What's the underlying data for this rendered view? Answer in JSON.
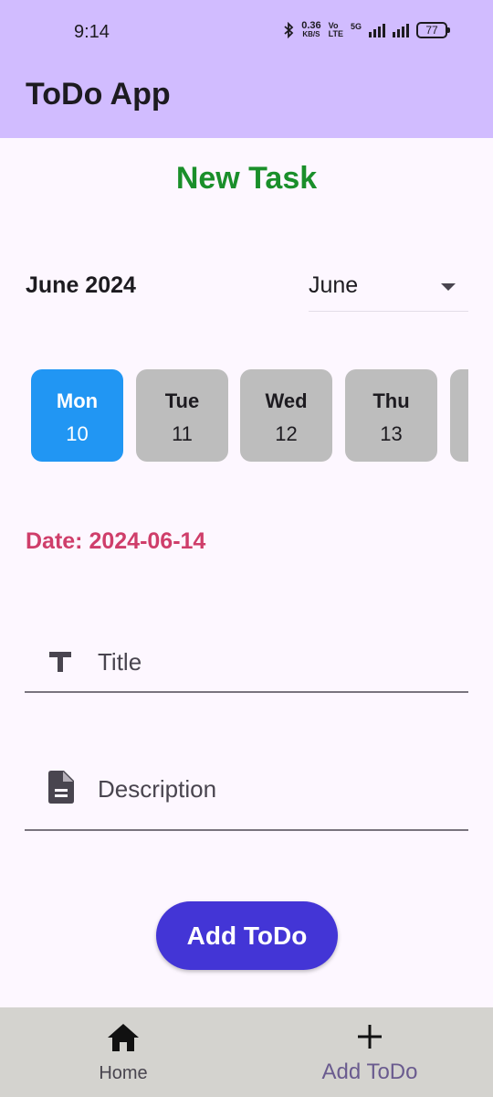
{
  "status_bar": {
    "time": "9:14",
    "net_speed": "0.36",
    "net_unit": "KB/S",
    "volte_top": "Vo",
    "volte_bottom": "LTE",
    "network": "5G",
    "battery": "77",
    "icons": [
      "bluetooth-icon",
      "signal-icon",
      "signal-icon",
      "battery-icon"
    ]
  },
  "app_bar": {
    "title": "ToDo App"
  },
  "page": {
    "heading": "New Task",
    "month_year": "June 2024",
    "month_select": {
      "value": "June"
    },
    "days": [
      {
        "name": "Mon",
        "num": "10",
        "selected": true
      },
      {
        "name": "Tue",
        "num": "11",
        "selected": false
      },
      {
        "name": "Wed",
        "num": "12",
        "selected": false
      },
      {
        "name": "Thu",
        "num": "13",
        "selected": false
      },
      {
        "name": "",
        "num": "",
        "selected": false
      }
    ],
    "selected_date": "Date: 2024-06-14",
    "title_field": {
      "placeholder": "Title",
      "value": ""
    },
    "description_field": {
      "placeholder": "Description",
      "value": ""
    },
    "add_button": "Add ToDo"
  },
  "bottom_nav": {
    "items": [
      {
        "label": "Home",
        "icon": "home-icon",
        "active": false
      },
      {
        "label": "Add ToDo",
        "icon": "plus-icon",
        "active": true
      }
    ]
  },
  "colors": {
    "app_bar": "#d1bcff",
    "heading": "#1a8f2a",
    "selected_day": "#2196f3",
    "date_text": "#cf3e6a",
    "button": "#4335d6",
    "nav_bg": "#d4d3cf",
    "nav_active": "#6a5b8f"
  }
}
